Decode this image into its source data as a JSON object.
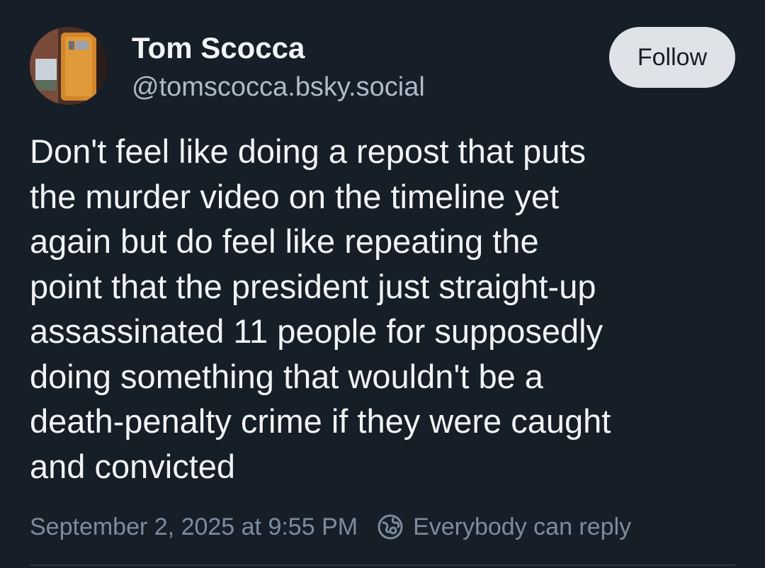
{
  "author": {
    "display_name": "Tom Scocca",
    "handle": "@tomscocca.bsky.social",
    "avatar_icon": "profile-photo"
  },
  "follow_button": {
    "label": "Follow"
  },
  "post": {
    "text": "Don't feel like doing a repost that puts\nthe murder video on the timeline yet\nagain but do feel like repeating the\npoint that the president just straight-up\nassassinated 11 people for supposedly\ndoing something that wouldn't be a\ndeath-penalty crime if they were caught\nand convicted"
  },
  "meta": {
    "timestamp": "September 2, 2025 at 9:55 PM",
    "reply_setting": "Everybody can reply",
    "reply_icon": "globe-icon"
  },
  "colors": {
    "background": "#161e27",
    "primary_text": "#f1f3f5",
    "secondary_text": "#aebbc9",
    "meta_text": "#7b8d9f",
    "follow_button_bg": "#dfe3e8"
  }
}
